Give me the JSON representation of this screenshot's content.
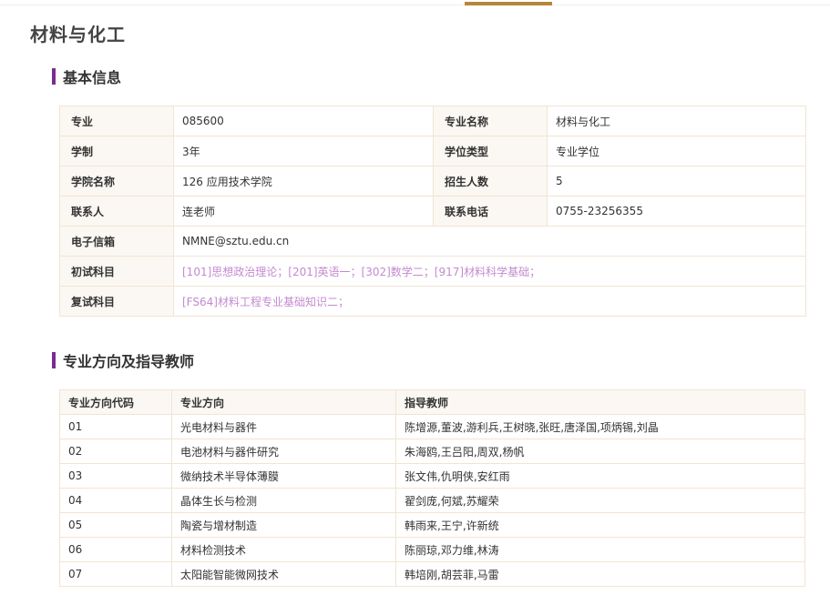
{
  "page": {
    "title": "材料与化工"
  },
  "colors": {
    "accent": "#b8863b",
    "section_bar": "#7b2c91",
    "subject_link": "#c38ad0",
    "label_bg": "#fbf8f3",
    "border": "#f1e4d3"
  },
  "basic_info": {
    "heading": "基本信息",
    "major_label": "专业",
    "major_value": "085600",
    "major_name_label": "专业名称",
    "major_name_value": "材料与化工",
    "duration_label": "学制",
    "duration_value": "3年",
    "degree_type_label": "学位类型",
    "degree_type_value": "专业学位",
    "college_label": "学院名称",
    "college_value": "126 应用技术学院",
    "enrollment_label": "招生人数",
    "enrollment_value": "5",
    "contact_label": "联系人",
    "contact_value": "连老师",
    "phone_label": "联系电话",
    "phone_value": "0755-23256355",
    "email_label": "电子信箱",
    "email_value": "NMNE@sztu.edu.cn",
    "prelim_label": "初试科目",
    "prelim_value": "[101]思想政治理论；[201]英语一；[302]数学二；[917]材料科学基础；",
    "retest_label": "复试科目",
    "retest_value": "[FS64]材料工程专业基础知识二；"
  },
  "directions": {
    "heading": "专业方向及指导教师",
    "columns": [
      "专业方向代码",
      "专业方向",
      "指导教师"
    ],
    "rows": [
      {
        "code": "01",
        "name": "光电材料与器件",
        "advisors": "陈增源,董波,游利兵,王树晓,张旺,唐泽国,项炳锡,刘晶"
      },
      {
        "code": "02",
        "name": "电池材料与器件研究",
        "advisors": "朱海鸥,王吕阳,周双,杨帆"
      },
      {
        "code": "03",
        "name": "微纳技术半导体薄膜",
        "advisors": "张文伟,仇明侠,安红雨"
      },
      {
        "code": "04",
        "name": "晶体生长与检测",
        "advisors": "翟剑庞,何斌,苏耀荣"
      },
      {
        "code": "05",
        "name": "陶瓷与增材制造",
        "advisors": "韩雨来,王宁,许新统"
      },
      {
        "code": "06",
        "name": "材料检测技术",
        "advisors": "陈丽琼,邓力维,林涛"
      },
      {
        "code": "07",
        "name": "太阳能智能微网技术",
        "advisors": "韩培刚,胡芸菲,马雷"
      }
    ]
  }
}
